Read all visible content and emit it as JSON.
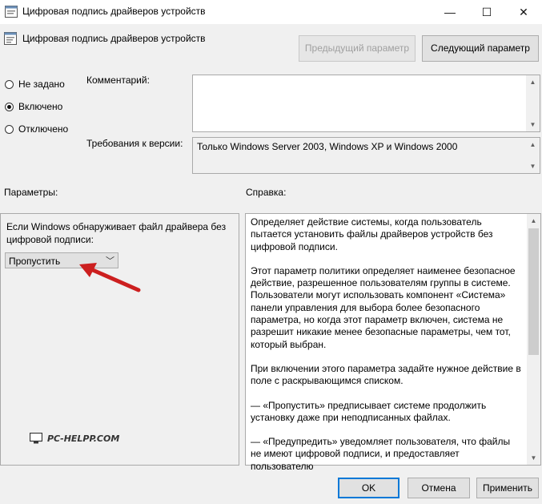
{
  "window": {
    "title": "Цифровая подпись драйверов устройств",
    "minimize_glyph": "—",
    "maximize_glyph": "☐",
    "close_glyph": "✕"
  },
  "header": {
    "title": "Цифровая подпись драйверов устройств",
    "prev_button": "Предыдущий параметр",
    "next_button": "Следующий параметр"
  },
  "state_options": [
    {
      "label": "Не задано",
      "checked": false
    },
    {
      "label": "Включено",
      "checked": true
    },
    {
      "label": "Отключено",
      "checked": false
    }
  ],
  "comment": {
    "label": "Комментарий:",
    "value": ""
  },
  "version": {
    "label": "Требования к версии:",
    "value": "Только Windows Server 2003, Windows XP и Windows 2000"
  },
  "params": {
    "heading": "Параметры:",
    "description": "Если Windows обнаруживает файл драйвера без цифровой подписи:",
    "dropdown_value": "Пропустить"
  },
  "help": {
    "heading": "Справка:",
    "paragraphs": [
      "Определяет действие системы, когда пользователь пытается установить файлы драйверов устройств без цифровой подписи.",
      "Этот параметр политики определяет наименее безопасное действие, разрешенное пользователям группы в системе. Пользователи могут использовать компонент «Система» панели управления для выбора более безопасного параметра, но когда этот параметр включен, система не разрешит никакие менее безопасные параметры, чем тот, который выбран.",
      "При включении этого параметра задайте нужное действие в поле с раскрывающимся списком.",
      "— «Пропустить» предписывает системе продолжить установку даже при неподписанных файлах.",
      "— «Предупредить» уведомляет пользователя, что файлы не имеют цифровой подписи, и предоставляет пользователю"
    ]
  },
  "watermark": "PC-HELPP.COM",
  "footer": {
    "ok": "OK",
    "cancel": "Отмена",
    "apply": "Применить"
  },
  "colors": {
    "arrow": "#cc1f1f",
    "primary_border": "#0078d7"
  }
}
